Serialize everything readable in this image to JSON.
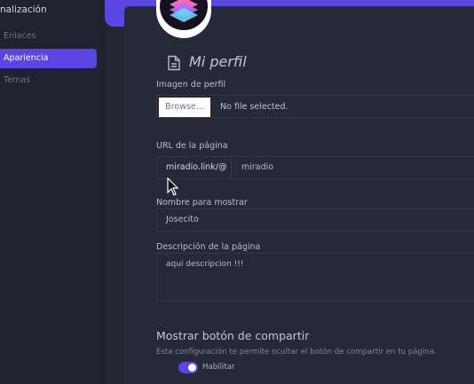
{
  "sidebar": {
    "section_title": "nalización",
    "items": [
      {
        "label": "Enlaces",
        "active": false
      },
      {
        "label": "Apariencia",
        "active": true
      },
      {
        "label": "Temas",
        "active": false
      }
    ]
  },
  "profile": {
    "title": "Mi perfil",
    "title_icon": "page-icon",
    "image_label": "Imagen de perfil",
    "browse_label": "Browse...",
    "file_status": "No file selected.",
    "url_label": "URL de la página",
    "url_prefix": "miradio.link/@",
    "url_value": "miradio",
    "display_name_label": "Nombre para mostrar",
    "display_name_value": "Josecito",
    "description_label": "Descripción de la página",
    "description_value": "aqui descripcion !!!",
    "share_title": "Mostrar botón de compartir",
    "share_description": "Esta configuración te permite ocultar el botón de compartir en tu página.",
    "share_toggle_label": "Habilitar",
    "share_enabled": true
  },
  "colors": {
    "accent": "#5b45e3",
    "background": "#222633",
    "card": "#262a38"
  }
}
